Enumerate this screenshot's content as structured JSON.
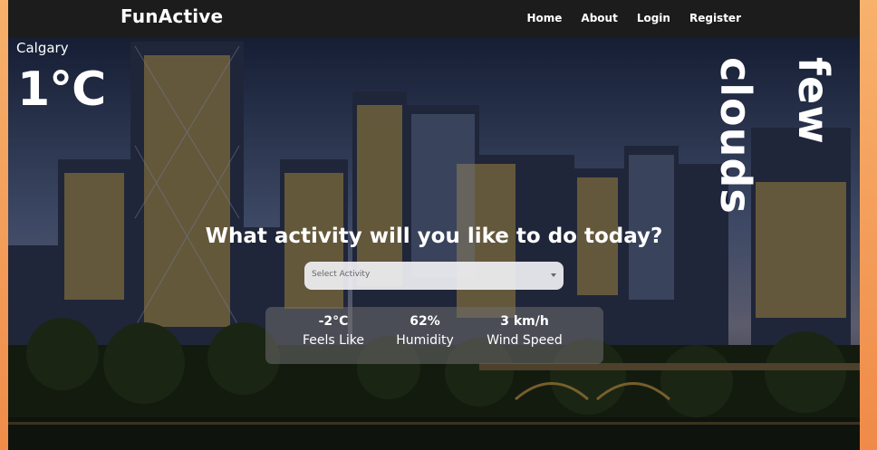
{
  "app": {
    "brand": "FunActive"
  },
  "nav": {
    "items": [
      "Home",
      "About",
      "Login",
      "Register"
    ]
  },
  "weather": {
    "city": "Calgary",
    "temperature": "1°C",
    "condition_word1": "few",
    "condition_word2": "clouds"
  },
  "prompt": "What activity will you like to do today?",
  "activity_select": {
    "placeholder": "Select Activity"
  },
  "stats": {
    "feels_like": {
      "value": "-2°C",
      "label": "Feels Like"
    },
    "humidity": {
      "value": "62%",
      "label": "Humidity"
    },
    "wind_speed": {
      "value": "3 km/h",
      "label": "Wind Speed"
    }
  },
  "colors": {
    "navbar": "#1c1c1c",
    "side_border": "#f0a060"
  }
}
